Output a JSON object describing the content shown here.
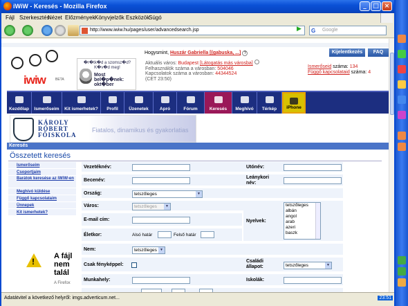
{
  "window": {
    "title": "iWiW - Keresés - Mozilla Firefox",
    "min": "_",
    "max": "□",
    "close": "×"
  },
  "menu": [
    "Fájl",
    "Szerkesztés",
    "Nézet",
    "Előzmények",
    "Könyvjelzők",
    "Eszközök",
    "Súgó"
  ],
  "nav": {
    "url": "http://www.iwiw.hu/pages/user/advancedsearch.jsp",
    "search_placeholder": "Google",
    "go": "▶"
  },
  "status": {
    "text": "Adatátvitel a következő helyről: imgs.adverticum.net...",
    "clock": "23:51"
  },
  "logo": {
    "text": "iwiw",
    "beta": "BETA"
  },
  "promo": {
    "line1": "�r�tk�d a szomsz�d? K�v�d meg!",
    "line2": "Most bel�p�nek: okt�ber"
  },
  "header": {
    "greeting": "Hogysmint,",
    "user": "Huszár Gabriella [(gabuska, ...]",
    "help": "?",
    "city_label": "Aktuális város:",
    "city": "Budapest",
    "city_link": "[Látogatás más városba]",
    "users_label": "Felhasználók száma a városban:",
    "users": "504046",
    "conn_label": "Kapcsolatok száma a városban:",
    "conn": "44344524",
    "time": "(CET 23:50)",
    "logout": "Kijelentkezés",
    "faq": "FAQ",
    "friends_label": "Ismerőseid",
    "friends_suffix": "száma:",
    "friends": "134",
    "pending_label": "Függő kapcsolataid",
    "pending_suffix": "száma:",
    "pending": "4"
  },
  "iconnav": [
    "Kezdőlap",
    "Ismerőseim",
    "Kit ismerhetek?",
    "Profil",
    "Üzenetek",
    "Apró",
    "Fórum",
    "Keresés",
    "Meghívó",
    "Térkép",
    "iPhone"
  ],
  "banner": {
    "line1": "KÁROLY",
    "line2": "RÓBERT",
    "line3": "FŐISKOLA",
    "slogan": "Fiatalos, dinamikus és gyakorlatias"
  },
  "breadcrumb": "Keresés",
  "page_title": "Összetett keresés",
  "leftmenu": [
    "Ismerőseim",
    "Csoportjaim",
    "Barátok keresése az iWiW-en",
    "Meghívó küldése",
    "Függő kapcsolataim",
    "Ünnepek",
    "Kit ismerhetek?"
  ],
  "alert": {
    "title": "A fájl nem talál",
    "small": "A Firefox"
  },
  "form": {
    "last_name": "Vezetéknév:",
    "first_name": "Utónév:",
    "nickname": "Becenév:",
    "maiden": "Leánykori név:",
    "country": "Ország:",
    "country_val": "tetszőleges",
    "city": "Város:",
    "city_val": "tetszőleges",
    "email": "E-mail cím:",
    "languages": "Nyelvek:",
    "lang_options": [
      "tetszőleges",
      "albán",
      "angol",
      "arab",
      "azeri",
      "baszk"
    ],
    "age": "Életkor:",
    "age_low": "Alsó határ",
    "age_high": "Felső határ",
    "gender": "Nem:",
    "gender_val": "tetszőleges",
    "photo_only": "Csak fényképpel:",
    "marital": "Családi állapot:",
    "marital_val": "tetszőleges",
    "workplace": "Munkahely:",
    "school": "Iskolák:"
  }
}
